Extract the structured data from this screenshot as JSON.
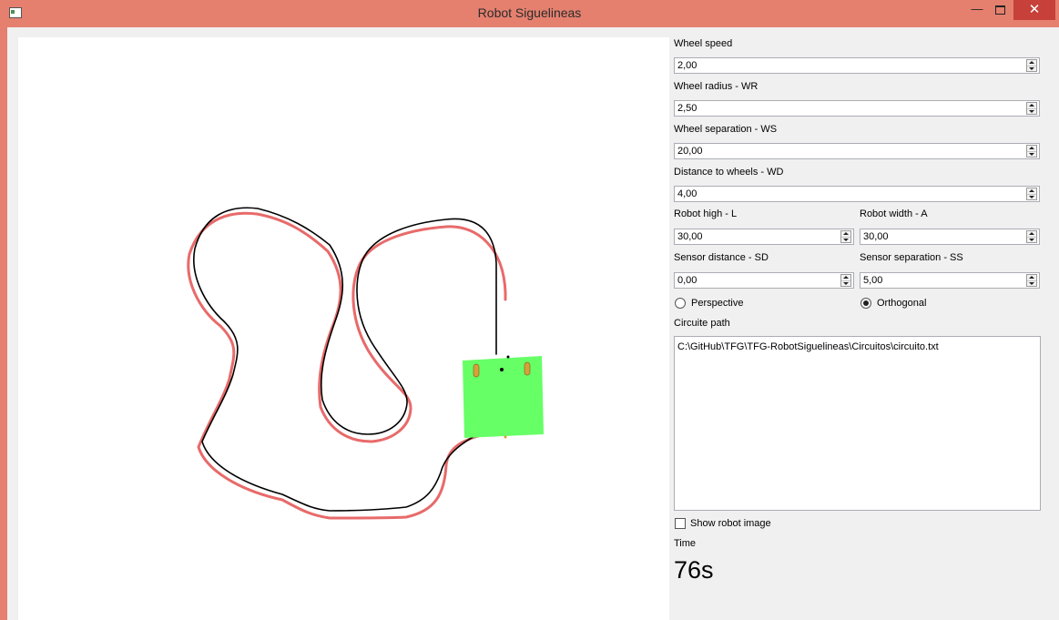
{
  "window": {
    "title": "Robot Siguelineas",
    "minimize": "—",
    "close": "✕"
  },
  "icons": {
    "app": "app-window-icon",
    "maximize": "maximize-icon"
  },
  "colors": {
    "titlebar": "#e5806f",
    "close_button": "#c7403a",
    "track_outline": "#e86a6a",
    "track_line": "#000000",
    "robot_body": "#66ff66",
    "robot_wheels": "#d8a03a"
  },
  "params": {
    "wheel_speed": {
      "label": "Wheel speed",
      "value": "2,00"
    },
    "wheel_radius": {
      "label": "Wheel radius - WR",
      "value": "2,50"
    },
    "wheel_separation": {
      "label": "Wheel separation - WS",
      "value": "20,00"
    },
    "distance_to_wheels": {
      "label": "Distance to wheels - WD",
      "value": "4,00"
    },
    "robot_high": {
      "label": "Robot high - L",
      "value": "30,00"
    },
    "robot_width": {
      "label": "Robot width - A",
      "value": "30,00"
    },
    "sensor_distance": {
      "label": "Sensor distance - SD",
      "value": "0,00"
    },
    "sensor_separation": {
      "label": "Sensor separation - SS",
      "value": "5,00"
    }
  },
  "projection": {
    "perspective_label": "Perspective",
    "orthogonal_label": "Orthogonal",
    "selected": "Orthogonal"
  },
  "circuit": {
    "label": "Circuite path",
    "path": "C:\\GitHub\\TFG\\TFG-RobotSiguelineas\\Circuitos\\circuito.txt"
  },
  "show_robot_image": {
    "label": "Show robot image",
    "checked": false
  },
  "time": {
    "label": "Time",
    "value": "76s"
  }
}
